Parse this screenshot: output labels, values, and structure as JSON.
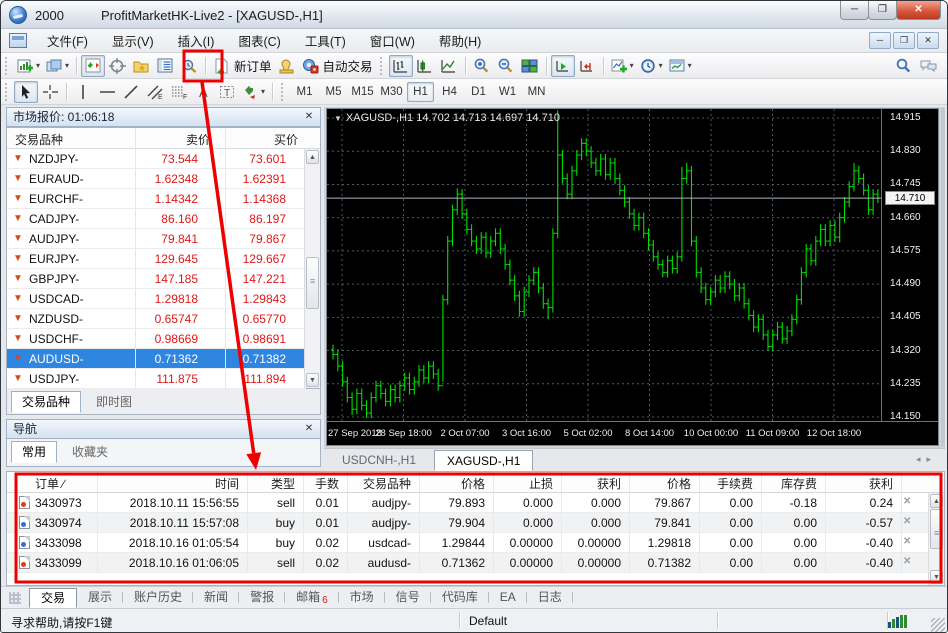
{
  "window": {
    "account": "2000",
    "title": "ProfitMarketHK-Live2 - [XAGUSD-,H1]",
    "buttons": {
      "minimize": "─",
      "restore": "❐",
      "close": "✕"
    }
  },
  "menu": {
    "items": [
      "文件(F)",
      "显示(V)",
      "插入(I)",
      "图表(C)",
      "工具(T)",
      "窗口(W)",
      "帮助(H)"
    ]
  },
  "toolbar": {
    "new_order_label": "新订单",
    "autotrading_label": "自动交易",
    "timeframes": [
      "M1",
      "M5",
      "M15",
      "M30",
      "H1",
      "H4",
      "D1",
      "W1",
      "MN"
    ],
    "active_timeframe": "H1"
  },
  "market_watch": {
    "title": "市场报价: 01:06:18",
    "columns": [
      "交易品种",
      "卖价",
      "买价"
    ],
    "rows": [
      {
        "symbol": "NZDJPY-",
        "bid": "73.544",
        "ask": "73.601"
      },
      {
        "symbol": "EURAUD-",
        "bid": "1.62348",
        "ask": "1.62391"
      },
      {
        "symbol": "EURCHF-",
        "bid": "1.14342",
        "ask": "1.14368"
      },
      {
        "symbol": "CADJPY-",
        "bid": "86.160",
        "ask": "86.197"
      },
      {
        "symbol": "AUDJPY-",
        "bid": "79.841",
        "ask": "79.867"
      },
      {
        "symbol": "EURJPY-",
        "bid": "129.645",
        "ask": "129.667"
      },
      {
        "symbol": "GBPJPY-",
        "bid": "147.185",
        "ask": "147.221"
      },
      {
        "symbol": "USDCAD-",
        "bid": "1.29818",
        "ask": "1.29843"
      },
      {
        "symbol": "NZDUSD-",
        "bid": "0.65747",
        "ask": "0.65770"
      },
      {
        "symbol": "USDCHF-",
        "bid": "0.98669",
        "ask": "0.98691"
      },
      {
        "symbol": "AUDUSD-",
        "bid": "0.71362",
        "ask": "0.71382"
      },
      {
        "symbol": "USDJPY-",
        "bid": "111.875",
        "ask": "111.894"
      }
    ],
    "selected_symbol": "AUDUSD-",
    "tabs": [
      "交易品种",
      "即时图"
    ],
    "active_tab": "交易品种"
  },
  "navigator": {
    "title": "导航",
    "tabs": [
      "常用",
      "收藏夹"
    ],
    "active_tab": "常用"
  },
  "chart": {
    "header": "XAGUSD-,H1 14.702 14.713 14.697 14.710",
    "current_price": "14.710",
    "grid_prices": [
      "14.915",
      "14.830",
      "14.745",
      "14.660",
      "14.575",
      "14.490",
      "14.405",
      "14.320",
      "14.235",
      "14.150"
    ],
    "time_labels": [
      "27 Sep 2018",
      "28 Sep 18:00",
      "2 Oct 07:00",
      "3 Oct 16:00",
      "5 Oct 02:00",
      "8 Oct 14:00",
      "10 Oct 00:00",
      "11 Oct 09:00",
      "12 Oct 18:00"
    ],
    "window_tabs": [
      "USDCNH-,H1",
      "XAGUSD-,H1"
    ],
    "active_window_tab": "XAGUSD-,H1"
  },
  "chart_data": {
    "type": "ohlc-bar",
    "symbol": "XAGUSD-",
    "timeframe": "H1",
    "ylim": [
      14.13,
      14.95
    ],
    "grid": true,
    "closes": [
      14.31,
      14.28,
      14.24,
      14.2,
      14.17,
      14.21,
      14.18,
      14.16,
      14.2,
      14.23,
      14.21,
      14.19,
      14.22,
      14.2,
      14.23,
      14.25,
      14.22,
      14.24,
      14.27,
      14.25,
      14.28,
      14.26,
      14.23,
      14.45,
      14.6,
      14.68,
      14.72,
      14.67,
      14.63,
      14.6,
      14.58,
      14.61,
      14.57,
      14.6,
      14.62,
      14.58,
      14.54,
      14.5,
      14.46,
      14.42,
      14.47,
      14.5,
      14.52,
      14.48,
      14.44,
      14.43,
      14.62,
      14.82,
      14.76,
      14.72,
      14.78,
      14.82,
      14.85,
      14.83,
      14.8,
      14.78,
      14.81,
      14.77,
      14.8,
      14.76,
      14.73,
      14.7,
      14.67,
      14.64,
      14.66,
      14.62,
      14.59,
      14.56,
      14.54,
      14.52,
      14.55,
      14.53,
      14.56,
      14.76,
      14.78,
      14.6,
      14.52,
      14.48,
      14.45,
      14.47,
      14.5,
      14.48,
      14.51,
      14.49,
      14.46,
      14.48,
      14.44,
      14.41,
      14.38,
      14.4,
      14.36,
      14.33,
      14.36,
      14.38,
      14.35,
      14.37,
      14.4,
      14.45,
      14.52,
      14.58,
      14.55,
      14.6,
      14.63,
      14.6,
      14.64,
      14.61,
      14.66,
      14.7,
      14.74,
      14.78,
      14.76,
      14.73,
      14.68,
      14.72,
      14.71
    ],
    "high_overrides": {
      "26": 14.735,
      "47": 14.935,
      "73": 14.79,
      "74": 14.8,
      "109": 14.8
    },
    "low_overrides": {
      "4": 14.155,
      "7": 14.148,
      "23": 14.24,
      "45": 14.4,
      "91": 14.32
    }
  },
  "terminal": {
    "sort_indicator": "∕",
    "columns": [
      "订单",
      "时间",
      "类型",
      "手数",
      "交易品种",
      "价格",
      "止损",
      "获利",
      "价格",
      "手续费",
      "库存费",
      "获利"
    ],
    "orders": [
      {
        "ticket": "3430973",
        "time": "2018.10.11 15:56:55",
        "type": "sell",
        "lots": "0.01",
        "symbol": "audjpy-",
        "price": "79.893",
        "sl": "0.000",
        "tp": "0.000",
        "price2": "79.867",
        "commission": "0.00",
        "swap": "-0.18",
        "profit": "0.24"
      },
      {
        "ticket": "3430974",
        "time": "2018.10.11 15:57:08",
        "type": "buy",
        "lots": "0.01",
        "symbol": "audjpy-",
        "price": "79.904",
        "sl": "0.000",
        "tp": "0.000",
        "price2": "79.841",
        "commission": "0.00",
        "swap": "0.00",
        "profit": "-0.57"
      },
      {
        "ticket": "3433098",
        "time": "2018.10.16 01:05:54",
        "type": "buy",
        "lots": "0.02",
        "symbol": "usdcad-",
        "price": "1.29844",
        "sl": "0.00000",
        "tp": "0.00000",
        "price2": "1.29818",
        "commission": "0.00",
        "swap": "0.00",
        "profit": "-0.40"
      },
      {
        "ticket": "3433099",
        "time": "2018.10.16 01:06:05",
        "type": "sell",
        "lots": "0.02",
        "symbol": "audusd-",
        "price": "0.71362",
        "sl": "0.00000",
        "tp": "0.00000",
        "price2": "0.71382",
        "commission": "0.00",
        "swap": "0.00",
        "profit": "-0.40"
      }
    ]
  },
  "bottom_tabs": {
    "items": [
      "交易",
      "展示",
      "账户历史",
      "新闻",
      "警报",
      "邮箱",
      "市场",
      "信号",
      "代码库",
      "EA",
      "日志"
    ],
    "active": "交易",
    "mail_badge": "6"
  },
  "status_bar": {
    "help_text": "寻求帮助,请按F1键",
    "profile": "Default"
  },
  "colors": {
    "annotation": "#ee0000",
    "price_down": "#e01818",
    "selection": "#2e86e0",
    "bar_green": "#00dd00",
    "chart_bg": "#000000",
    "grid": "#4e5c66"
  }
}
